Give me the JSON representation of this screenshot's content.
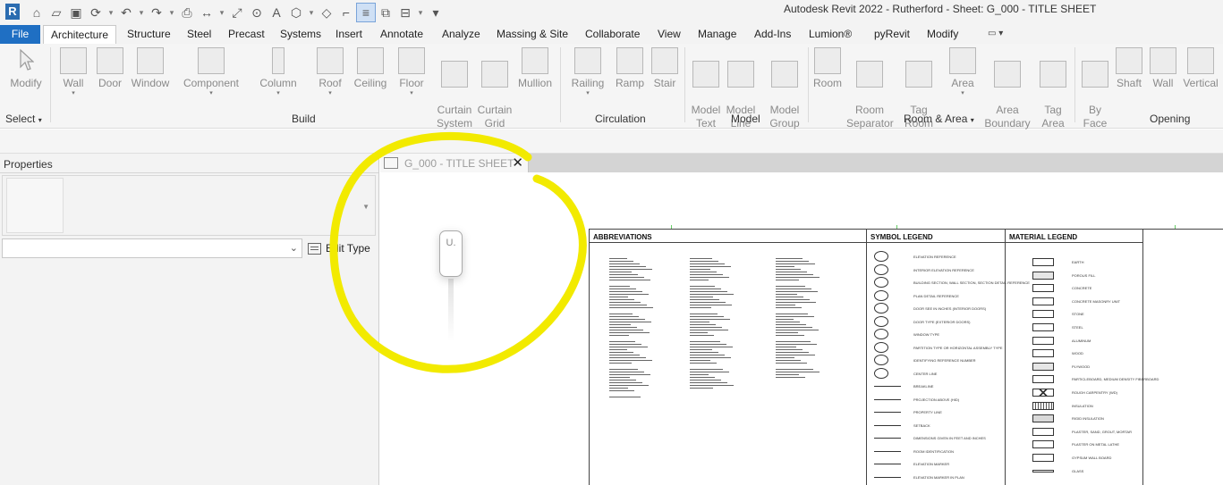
{
  "app": {
    "logo": "R",
    "window_title": "Autodesk Revit 2022 - Rutherford - Sheet: G_000 - TITLE SHEET"
  },
  "qat": {
    "icons": [
      "home-icon",
      "open-icon",
      "save-icon",
      "sync-icon",
      "undo-icon",
      "redo-icon",
      "print-icon",
      "measure-icon",
      "dimension-icon",
      "tag-icon",
      "text-icon",
      "3d-view-icon",
      "section-icon",
      "detail-line-icon",
      "thin-lines-icon",
      "close-windows-icon",
      "switch-windows-icon",
      "customize-icon"
    ]
  },
  "ribbon_tabs": [
    {
      "label": "File",
      "active": false
    },
    {
      "label": "Architecture",
      "active": true
    },
    {
      "label": "Structure"
    },
    {
      "label": "Steel"
    },
    {
      "label": "Precast"
    },
    {
      "label": "Systems"
    },
    {
      "label": "Insert"
    },
    {
      "label": "Annotate"
    },
    {
      "label": "Analyze"
    },
    {
      "label": "Massing & Site"
    },
    {
      "label": "Collaborate"
    },
    {
      "label": "View"
    },
    {
      "label": "Manage"
    },
    {
      "label": "Add-Ins"
    },
    {
      "label": "Lumion®"
    },
    {
      "label": "pyRevit"
    },
    {
      "label": "Modify"
    }
  ],
  "ribbon": {
    "buttons": [
      {
        "label": "Modify",
        "icon": "cursor-icon"
      },
      {
        "label": "Wall",
        "icon": "wall-icon",
        "dropdown": true
      },
      {
        "label": "Door",
        "icon": "door-icon"
      },
      {
        "label": "Window",
        "icon": "window-icon"
      },
      {
        "label": "Component",
        "icon": "component-icon",
        "dropdown": true
      },
      {
        "label": "Column",
        "icon": "column-icon",
        "dropdown": true
      },
      {
        "label": "Roof",
        "icon": "roof-icon",
        "dropdown": true
      },
      {
        "label": "Ceiling",
        "icon": "ceiling-icon"
      },
      {
        "label": "Floor",
        "icon": "floor-icon",
        "dropdown": true
      },
      {
        "label": "Curtain\nSystem",
        "icon": "curtain-system-icon"
      },
      {
        "label": "Curtain\nGrid",
        "icon": "curtain-grid-icon"
      },
      {
        "label": "Mullion",
        "icon": "mullion-icon"
      },
      {
        "label": "Railing",
        "icon": "railing-icon",
        "dropdown": true
      },
      {
        "label": "Ramp",
        "icon": "ramp-icon"
      },
      {
        "label": "Stair",
        "icon": "stair-icon"
      },
      {
        "label": "Model\nText",
        "icon": "model-text-icon"
      },
      {
        "label": "Model\nLine",
        "icon": "model-line-icon"
      },
      {
        "label": "Model\nGroup",
        "icon": "model-group-icon",
        "dropdown": true
      },
      {
        "label": "Room",
        "icon": "room-icon"
      },
      {
        "label": "Room\nSeparator",
        "icon": "room-separator-icon"
      },
      {
        "label": "Tag\nRoom",
        "icon": "tag-room-icon",
        "dropdown": true
      },
      {
        "label": "Area",
        "icon": "area-icon",
        "dropdown": true
      },
      {
        "label": "Area\nBoundary",
        "icon": "area-boundary-icon"
      },
      {
        "label": "Tag\nArea",
        "icon": "tag-area-icon",
        "dropdown": true
      },
      {
        "label": "By\nFace",
        "icon": "by-face-icon"
      },
      {
        "label": "Shaft",
        "icon": "shaft-icon"
      },
      {
        "label": "Wall",
        "icon": "wall-opening-icon"
      },
      {
        "label": "Vertical",
        "icon": "vertical-opening-icon"
      }
    ],
    "panels": [
      "Select",
      "Build",
      "Circulation",
      "Model",
      "Room & Area",
      "Opening"
    ]
  },
  "properties": {
    "title": "Properties",
    "type_selector_value": "",
    "edit_type_label": "Edit Type"
  },
  "view": {
    "tab_label": "G_000 - TITLE SHEET",
    "cursor_badge": "U."
  },
  "sheet": {
    "abbreviations_title": "ABBREVIATIONS",
    "symbol_legend_title": "SYMBOL LEGEND",
    "material_legend_title": "MATERIAL LEGEND",
    "symbols": [
      "ELEVATION REFERENCE",
      "INTERIOR ELEVATION REFERENCE",
      "BUILDING SECTION, WALL SECTION, SECTION DETAIL REFERENCE",
      "PLAN DETAIL REFERENCE",
      "DOOR SEE IN INCHES (INTERIOR DOORS)",
      "DOOR TYPE (EXTERIOR DOORS)",
      "WINDOW TYPE",
      "PARTITION TYPE OR HORIZONTAL ASSEMBLY TYPE",
      "IDENTIFYING REFERENCE NUMBER",
      "CENTER LINE",
      "BREAKLINE",
      "PROJECTION ABOVE (HID)",
      "PROPERTY LINE",
      "SETBACK",
      "DIMENSIONS GIVEN IN FEET AND INCHES",
      "ROOM IDENTIFICATION",
      "ELEVATION MARKER",
      "ELEVATION MARKER IN PLAN"
    ],
    "materials": [
      "EARTH",
      "POROUS FILL",
      "CONCRETE",
      "CONCRETE MASONRY UNIT",
      "STONE",
      "STEEL",
      "ALUMINUM",
      "WOOD",
      "PLYWOOD",
      "PARTICLEBOARD, MEDIUM DENSITY FIBERBOARD",
      "ROUGH CARPENTRY (WD)",
      "INSULATION",
      "RIGID INSULATION",
      "PLASTER, SAND, GROUT, MORTAR",
      "PLASTER ON METAL LATHE",
      "GYPSUM WALL BOARD",
      "GLASS"
    ]
  },
  "colors": {
    "file_tab": "#1f6fc3",
    "highlight": "#f2ea00"
  }
}
